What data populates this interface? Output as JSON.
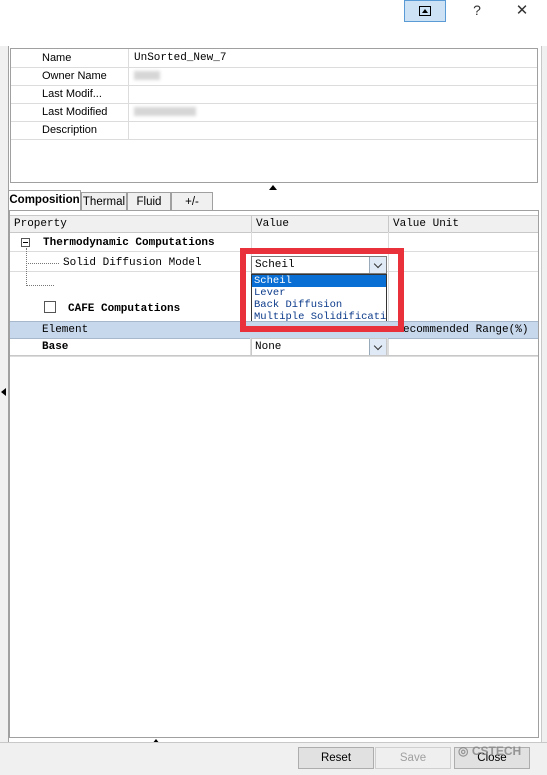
{
  "window": {
    "help_label": "?",
    "close_label": "✕"
  },
  "info": {
    "rows": [
      {
        "key": "Name",
        "value": "UnSorted_New_7"
      },
      {
        "key": "Owner Name",
        "value": ""
      },
      {
        "key": "Last Modif...",
        "value": ""
      },
      {
        "key": "Last Modified",
        "value": ""
      },
      {
        "key": "Description",
        "value": ""
      }
    ]
  },
  "tabs": [
    "Composition",
    "Thermal",
    "Fluid",
    "+/-"
  ],
  "grid": {
    "headers": {
      "property": "Property",
      "value": "Value",
      "unit": "Value Unit"
    },
    "thermo_label": "Thermodynamic Computations",
    "solid_diffusion_label": "Solid Diffusion Model",
    "solid_diffusion_value": "Scheil",
    "cafe_label": "CAFE Computations",
    "element_header": "Element",
    "range_header": "ecommended Range(%)",
    "base_label": "Base",
    "base_value": "None"
  },
  "dropdown": {
    "options": [
      "Scheil",
      "Lever",
      "Back Diffusion",
      "Multiple Solidificatio"
    ],
    "selected": "Scheil"
  },
  "buttons": {
    "reset": "Reset",
    "save": "Save",
    "close": "Close"
  },
  "watermark": "CSTECH",
  "colors": {
    "highlight": "#e8313a",
    "selection": "#0a6fd4",
    "element_row": "#c8d8ec"
  }
}
